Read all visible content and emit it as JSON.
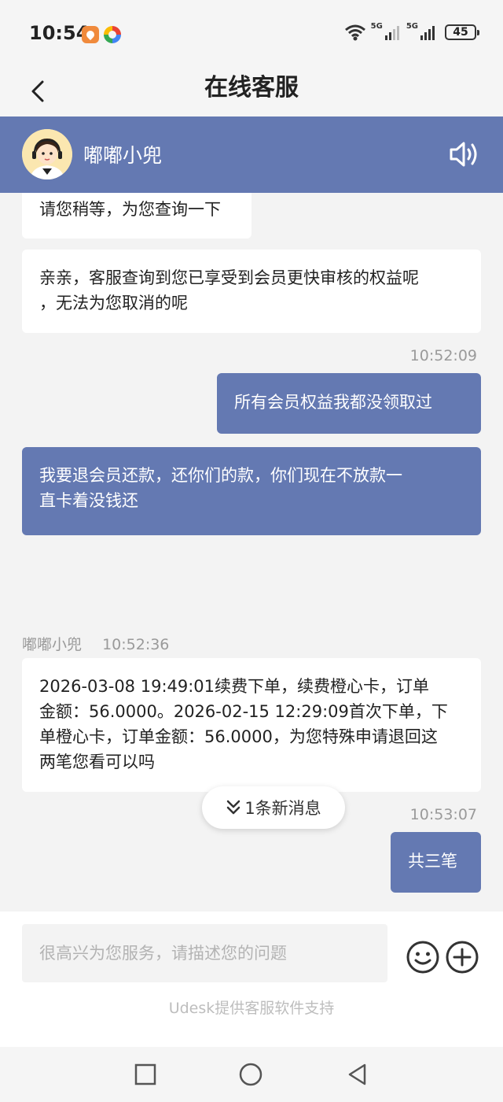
{
  "status_bar": {
    "time": "10:54",
    "net1": "5G",
    "net2": "5G",
    "battery": "45"
  },
  "header": {
    "title": "在线客服"
  },
  "agent": {
    "name": "嘟嘟小兜"
  },
  "messages": {
    "m1": "请您稍等，为您查询一下",
    "m2_l1": "亲亲，客服查询到您已享受到会员更快审核的权益呢",
    "m2_l2": "，无法为您取消的呢",
    "ts1": "10:52:09",
    "m3": "所有会员权益我都没领取过",
    "m4_l1": "我要退会员还款，还你们的款，你们现在不放款一",
    "m4_l2": "直卡着没钱还",
    "sender": "嘟嘟小兜",
    "ts2": "10:52:36",
    "m5_l1": "2026-03-08 19:49:01续费下单，续费橙心卡，订单",
    "m5_l2": "金额：56.0000。2026-02-15 12:29:09首次下单，下",
    "m5_l3": "单橙心卡，订单金额：56.0000，为您特殊申请退回这",
    "m5_l4": "两笔您看可以吗",
    "ts3": "10:53:07",
    "m6": "共三笔"
  },
  "new_message": {
    "label": "1条新消息"
  },
  "input": {
    "placeholder": "很高兴为您服务，请描述您的问题"
  },
  "footer": {
    "powered_by": "Udesk提供客服软件支持"
  },
  "colors": {
    "accent": "#6479b2",
    "background": "#f3f3f3"
  },
  "icons": [
    "back-icon",
    "speaker-icon",
    "emoji-icon",
    "plus-icon",
    "double-chevron-down-icon",
    "square-icon",
    "circle-icon",
    "triangle-back-icon"
  ]
}
